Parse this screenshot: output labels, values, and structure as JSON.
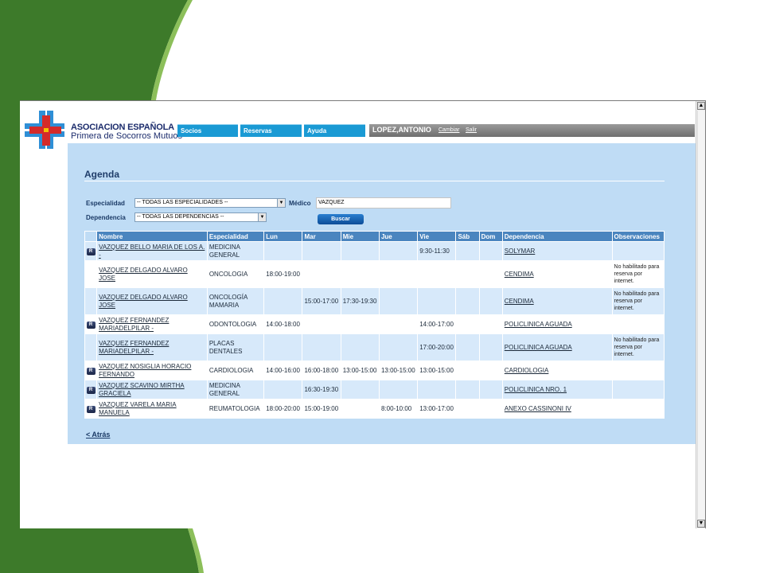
{
  "org": {
    "line1": "ASOCIACION ESPAÑOLA",
    "line2": "Primera de Socorros Mutuos"
  },
  "nav": {
    "items": [
      "Socios",
      "Reservas",
      "Ayuda"
    ]
  },
  "user": {
    "name": "LOPEZ,ANTONIO",
    "change_label": "Cambiar",
    "logout_label": "Salir"
  },
  "page": {
    "title": "Agenda",
    "back_label": "< Atrás"
  },
  "filters": {
    "especialidad_label": "Especialidad",
    "especialidad_value": "-- TODAS LAS ESPECIALIDADES --",
    "dependencia_label": "Dependencia",
    "dependencia_value": "-- TODAS LAS DEPENDENCIAS --",
    "medico_label": "Médico",
    "medico_value": "VAZQUEZ",
    "search_label": "Buscar"
  },
  "table": {
    "headers": [
      "Nombre",
      "Especialidad",
      "Lun",
      "Mar",
      "Mie",
      "Jue",
      "Vie",
      "Sáb",
      "Dom",
      "Dependencia",
      "Observaciones"
    ],
    "reserve_icon_label": "R",
    "rows": [
      {
        "reservable": true,
        "nombre": "VAZQUEZ BELLO MARIA DE LOS A. -",
        "especialidad": "MEDICINA GENERAL",
        "lun": "",
        "mar": "",
        "mie": "",
        "jue": "",
        "vie": "9:30-11:30",
        "sab": "",
        "dom": "",
        "dependencia": "SOLYMAR",
        "observaciones": ""
      },
      {
        "reservable": false,
        "nombre": "VAZQUEZ DELGADO ALVARO JOSE",
        "especialidad": "ONCOLOGIA",
        "lun": "18:00-19:00",
        "mar": "",
        "mie": "",
        "jue": "",
        "vie": "",
        "sab": "",
        "dom": "",
        "dependencia": "CENDIMA",
        "observaciones": "No habilitado para reserva por internet."
      },
      {
        "reservable": false,
        "nombre": "VAZQUEZ DELGADO ALVARO JOSE",
        "especialidad": "ONCOLOGÍA MAMARIA",
        "lun": "",
        "mar": "15:00-17:00",
        "mie": "17:30-19:30",
        "jue": "",
        "vie": "",
        "sab": "",
        "dom": "",
        "dependencia": "CENDIMA",
        "observaciones": "No habilitado para reserva por internet."
      },
      {
        "reservable": true,
        "nombre": "VAZQUEZ FERNANDEZ MARIADELPILAR -",
        "especialidad": "ODONTOLOGIA",
        "lun": "14:00-18:00",
        "mar": "",
        "mie": "",
        "jue": "",
        "vie": "14:00-17:00",
        "sab": "",
        "dom": "",
        "dependencia": "POLICLINICA AGUADA",
        "observaciones": ""
      },
      {
        "reservable": false,
        "nombre": "VAZQUEZ FERNANDEZ MARIADELPILAR -",
        "especialidad": "PLACAS DENTALES",
        "lun": "",
        "mar": "",
        "mie": "",
        "jue": "",
        "vie": "17:00-20:00",
        "sab": "",
        "dom": "",
        "dependencia": "POLICLINICA AGUADA",
        "observaciones": "No habilitado para reserva por internet."
      },
      {
        "reservable": true,
        "nombre": "VAZQUEZ NOSIGLIA HORACIO FERNANDO",
        "especialidad": "CARDIOLOGIA",
        "lun": "14:00-16:00",
        "mar": "16:00-18:00",
        "mie": "13:00-15:00",
        "jue": "13:00-15:00",
        "vie": "13:00-15:00",
        "sab": "",
        "dom": "",
        "dependencia": "CARDIOLOGIA",
        "observaciones": ""
      },
      {
        "reservable": true,
        "nombre": "VAZQUEZ SCAVINO MIRTHA GRACIELA",
        "especialidad": "MEDICINA GENERAL",
        "lun": "",
        "mar": "16:30-19:30",
        "mie": "",
        "jue": "",
        "vie": "",
        "sab": "",
        "dom": "",
        "dependencia": "POLICLINICA NRO. 1",
        "observaciones": ""
      },
      {
        "reservable": true,
        "nombre": "VAZQUEZ VARELA MARIA MANUELA",
        "especialidad": "REUMATOLOGIA",
        "lun": "18:00-20:00",
        "mar": "15:00-19:00",
        "mie": "",
        "jue": "8:00-10:00",
        "vie": "13:00-17:00",
        "sab": "",
        "dom": "",
        "dependencia": "ANEXO CASSINONI IV",
        "observaciones": ""
      }
    ]
  },
  "colors": {
    "slide_green_dark": "#3d7a2a",
    "slide_green_light": "#8cbf5a",
    "content_bg": "#bfdcf5",
    "nav_blue": "#1a9ad4",
    "header_blue": "#4a85bf",
    "row_alt": "#d7e9fa"
  }
}
